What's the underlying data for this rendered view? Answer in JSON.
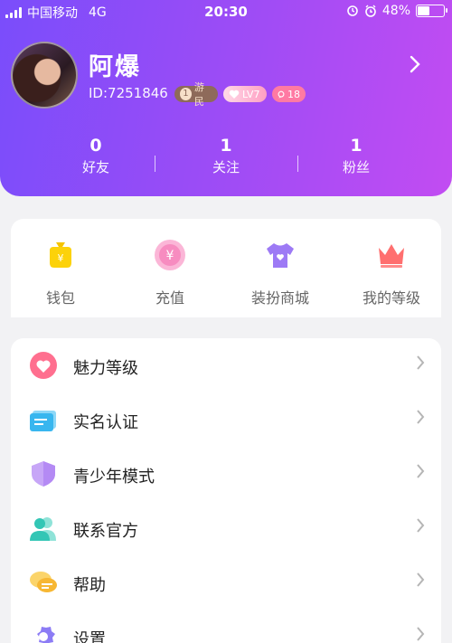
{
  "status_bar": {
    "carrier": "中国移动",
    "network": "4G",
    "time": "20:30",
    "battery": "48%",
    "battery_level": 0.48
  },
  "profile": {
    "name": "阿爆",
    "id_text": "ID:7251846",
    "level_badge": {
      "number": "1",
      "label": "游民"
    },
    "heart_badge": "LV7",
    "chat_badge": "18"
  },
  "stats": [
    {
      "value": "0",
      "label": "好友"
    },
    {
      "value": "1",
      "label": "关注"
    },
    {
      "value": "1",
      "label": "粉丝"
    }
  ],
  "shortcuts": [
    {
      "label": "钱包",
      "icon": "wallet-icon"
    },
    {
      "label": "充值",
      "icon": "recharge-icon"
    },
    {
      "label": "装扮商城",
      "icon": "tshirt-icon"
    },
    {
      "label": "我的等级",
      "icon": "crown-icon"
    }
  ],
  "menu": [
    {
      "label": "魅力等级",
      "icon": "heart-icon"
    },
    {
      "label": "实名认证",
      "icon": "id-card-icon"
    },
    {
      "label": "青少年模式",
      "icon": "shield-icon"
    },
    {
      "label": "联系官方",
      "icon": "contacts-icon"
    },
    {
      "label": "帮助",
      "icon": "help-chat-icon"
    },
    {
      "label": "设置",
      "icon": "gear-icon"
    }
  ],
  "colors": {
    "header_gradient_start": "#7a4dfb",
    "header_gradient_end": "#c24cf2",
    "accent_pink": "#ff7aa3"
  }
}
